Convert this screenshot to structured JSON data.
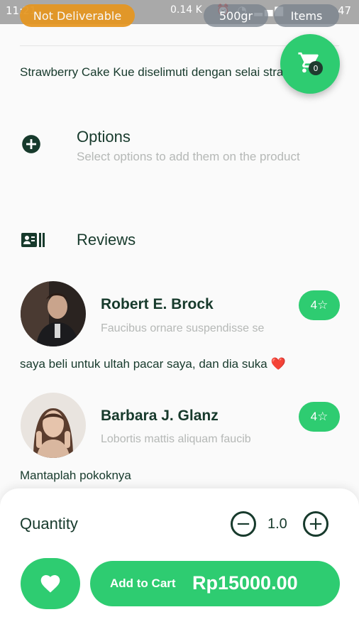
{
  "status_bar": {
    "time": "11:21",
    "network": "0.14 K",
    "battery": "47"
  },
  "product": {
    "deliverable_badge": "Not Deliverable",
    "weight": "500gr",
    "items_label": "Items",
    "description": "Strawberry Cake Kue diselimuti dengan selai strawberry",
    "cart_count": "0"
  },
  "options": {
    "title": "Options",
    "subtitle": "Select options to add them on the product",
    "icon": "add-circle-icon"
  },
  "reviews": {
    "title": "Reviews",
    "icon": "reviews-icon",
    "items": [
      {
        "name": "Robert E. Brock",
        "subtitle": "Faucibus ornare suspendisse se",
        "rating": "4",
        "comment": "saya beli untuk ultah pacar saya, dan dia suka ❤️"
      },
      {
        "name": "Barbara J. Glanz",
        "subtitle": "Lobortis mattis aliquam faucib",
        "rating": "4",
        "comment": "Mantaplah pokoknya"
      }
    ]
  },
  "bottom": {
    "quantity_label": "Quantity",
    "quantity_value": "1.0",
    "add_to_cart_label": "Add to Cart",
    "price": "Rp15000.00"
  },
  "colors": {
    "accent": "#2ecc71",
    "text_dark": "#173a2c",
    "warning": "#e6961f"
  }
}
